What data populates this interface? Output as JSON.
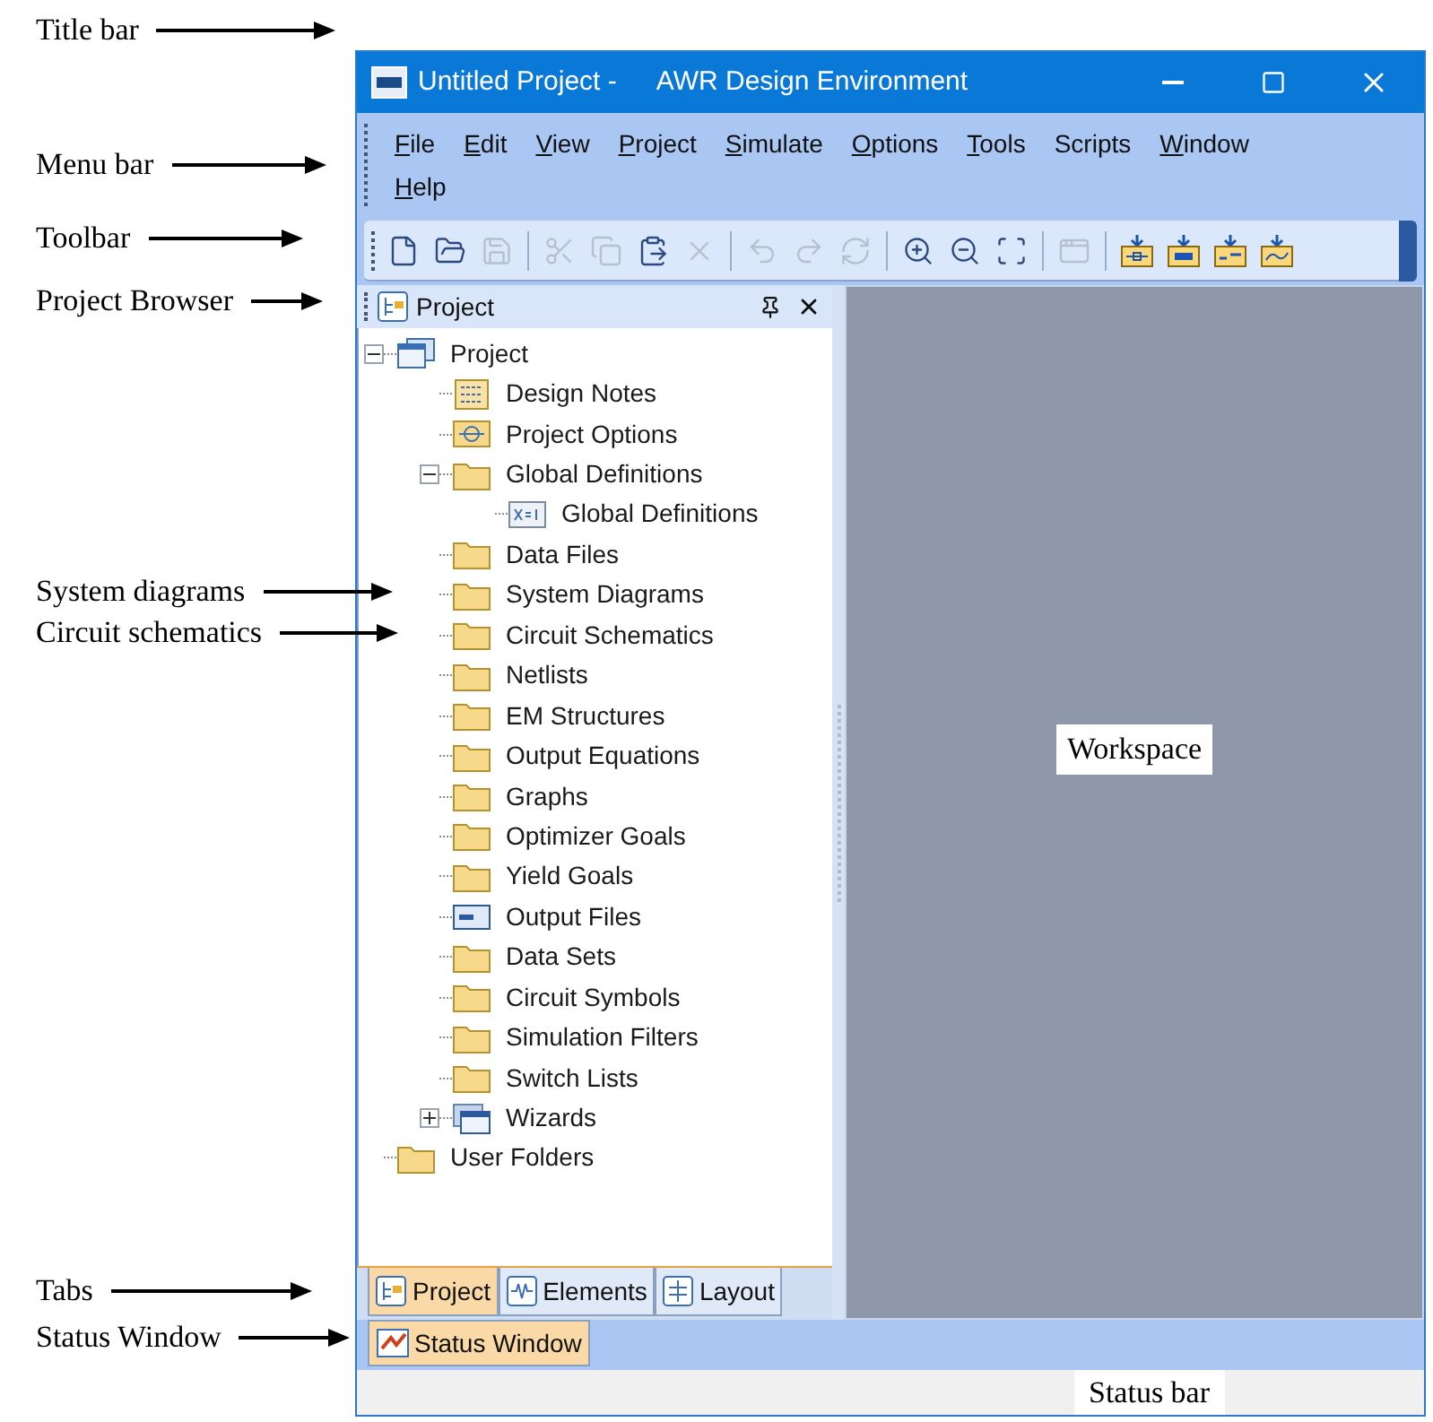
{
  "annotations": [
    {
      "text": "Title bar"
    },
    {
      "text": "Menu bar"
    },
    {
      "text": "Toolbar"
    },
    {
      "text": "Project Browser"
    },
    {
      "text": "System diagrams"
    },
    {
      "text": "Circuit schematics"
    },
    {
      "text": "Tabs"
    },
    {
      "text": "Status Window"
    }
  ],
  "window": {
    "title": "Untitled Project -",
    "app_name": "AWR Design Environment"
  },
  "menu": [
    {
      "key": "F",
      "rest": "ile"
    },
    {
      "key": "E",
      "rest": "dit"
    },
    {
      "key": "V",
      "rest": "iew"
    },
    {
      "key": "P",
      "rest": "roject"
    },
    {
      "key": "S",
      "rest": "imulate"
    },
    {
      "key": "O",
      "rest": "ptions"
    },
    {
      "key": "T",
      "rest": "ools"
    },
    {
      "rest": "Scripts"
    },
    {
      "key": "W",
      "rest": "indow"
    },
    {
      "key": "H",
      "rest": "elp"
    }
  ],
  "toolbar": [
    {
      "kind": "new",
      "disabled": false
    },
    {
      "kind": "open",
      "disabled": false
    },
    {
      "kind": "save",
      "disabled": true
    },
    {
      "kind": "separator"
    },
    {
      "kind": "cut",
      "disabled": true
    },
    {
      "kind": "copy",
      "disabled": true
    },
    {
      "kind": "paste",
      "disabled": false
    },
    {
      "kind": "delete",
      "disabled": true
    },
    {
      "kind": "separator"
    },
    {
      "kind": "undo",
      "disabled": true
    },
    {
      "kind": "redo",
      "disabled": true
    },
    {
      "kind": "refresh",
      "disabled": true
    },
    {
      "kind": "separator"
    },
    {
      "kind": "zoom-area",
      "disabled": false
    },
    {
      "kind": "zoom-out",
      "disabled": false
    },
    {
      "kind": "fit",
      "disabled": false
    },
    {
      "kind": "separator"
    },
    {
      "kind": "new-window",
      "disabled": true
    },
    {
      "kind": "separator"
    },
    {
      "kind": "add-diagram",
      "disabled": false
    },
    {
      "kind": "add-schematic",
      "disabled": false
    },
    {
      "kind": "add-netlist",
      "disabled": false
    },
    {
      "kind": "add-graph",
      "disabled": false
    }
  ],
  "project_browser": {
    "title": "Project",
    "tree": [
      {
        "label": "Project",
        "kind": "project",
        "expanded": true,
        "children": [
          {
            "label": "Design Notes",
            "kind": "notes"
          },
          {
            "label": "Project Options",
            "kind": "options"
          },
          {
            "label": "Global Definitions",
            "kind": "folder",
            "expanded": true,
            "children": [
              {
                "label": "Global Definitions",
                "kind": "definition"
              }
            ]
          },
          {
            "label": "Data Files",
            "kind": "folder"
          },
          {
            "label": "System Diagrams",
            "kind": "folder"
          },
          {
            "label": "Circuit Schematics",
            "kind": "folder"
          },
          {
            "label": "Netlists",
            "kind": "folder"
          },
          {
            "label": "EM Structures",
            "kind": "folder"
          },
          {
            "label": "Output Equations",
            "kind": "folder"
          },
          {
            "label": "Graphs",
            "kind": "folder"
          },
          {
            "label": "Optimizer Goals",
            "kind": "folder"
          },
          {
            "label": "Yield Goals",
            "kind": "folder"
          },
          {
            "label": "Output Files",
            "kind": "output"
          },
          {
            "label": "Data Sets",
            "kind": "folder"
          },
          {
            "label": "Circuit Symbols",
            "kind": "folder"
          },
          {
            "label": "Simulation Filters",
            "kind": "folder"
          },
          {
            "label": "Switch Lists",
            "kind": "folder"
          },
          {
            "label": "Wizards",
            "kind": "wizards",
            "expanded": false
          }
        ]
      },
      {
        "label": "User Folders",
        "kind": "folder"
      }
    ],
    "tabs": [
      {
        "label": "Project",
        "kind": "project",
        "selected": true
      },
      {
        "label": "Elements",
        "kind": "elements",
        "selected": false
      },
      {
        "label": "Layout",
        "kind": "layout",
        "selected": false
      }
    ]
  },
  "workspace": {
    "label": "Workspace"
  },
  "status_tabs": [
    {
      "label": "Status Window",
      "selected": true
    }
  ],
  "status_bar": {
    "label": "Status bar"
  }
}
